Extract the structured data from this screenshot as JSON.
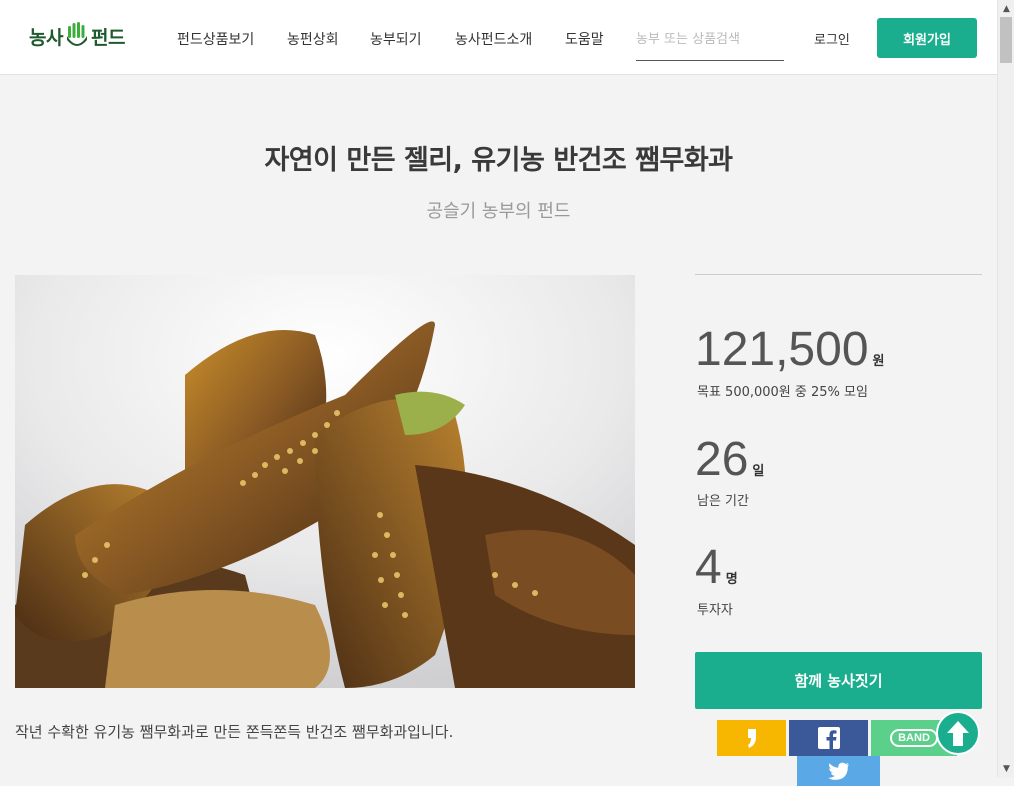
{
  "logo": {
    "text_left": "농사",
    "text_right": "펀드"
  },
  "nav": {
    "items": [
      {
        "label": "펀드상품보기"
      },
      {
        "label": "농펀상회"
      },
      {
        "label": "농부되기"
      },
      {
        "label": "농사펀드소개"
      },
      {
        "label": "도움말"
      }
    ],
    "search_placeholder": "농부 또는 상품검색",
    "login": "로그인",
    "signup": "회원가입"
  },
  "product": {
    "title": "자연이 만든 젤리, 유기농 반건조 쨈무화과",
    "subtitle": "공슬기 농부의 펀드",
    "description": "작년 수확한 유기농 쨈무화과로 만든 쫀득쫀득 반건조 쨈무화과입니다."
  },
  "funding": {
    "amount": "121,500",
    "amount_unit": "원",
    "goal_text": "목표 500,000원 중 25% 모임",
    "days": "26",
    "days_unit": "일",
    "days_label": "남은 기간",
    "investors": "4",
    "investors_unit": "명",
    "investors_label": "투자자",
    "cta": "함께 농사짓기"
  },
  "share": {
    "band_label": "BAND"
  },
  "colors": {
    "accent": "#1aae8e",
    "kakao": "#f7b600",
    "facebook": "#3b5998",
    "band": "#5bd08a",
    "twitter": "#5aa8e6"
  },
  "icons": [
    "hand-leaf-logo-icon",
    "kakao-icon",
    "facebook-icon",
    "band-icon",
    "twitter-icon",
    "arrow-up-icon"
  ]
}
